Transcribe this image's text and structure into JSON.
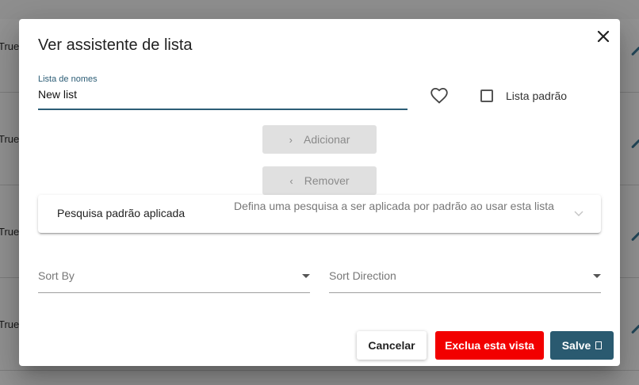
{
  "background": {
    "rows": [
      {
        "text": "True"
      },
      {
        "text": "True"
      },
      {
        "text": "True"
      },
      {
        "text": "True"
      }
    ]
  },
  "dialog": {
    "title": "Ver assistente de lista",
    "name_field": {
      "label": "Lista de nomes",
      "value": "New list"
    },
    "default_list_label": "Lista padrão",
    "add_button": "Adicionar",
    "remove_button": "Remover",
    "default_search": {
      "title": "Pesquisa padrão aplicada",
      "description": "Defina uma pesquisa a ser aplicada por padrão ao usar esta lista"
    },
    "sort_by_label": "Sort By",
    "sort_direction_label": "Sort Direction",
    "cancel_button": "Cancelar",
    "delete_button": "Exclua esta vista",
    "save_button": "Salve"
  },
  "colors": {
    "primary": "#2a5a70",
    "danger": "#f20000"
  },
  "icons": {
    "close": "close-icon",
    "favorite": "heart-icon",
    "expand": "chevron-down-icon",
    "save": "save-icon"
  }
}
